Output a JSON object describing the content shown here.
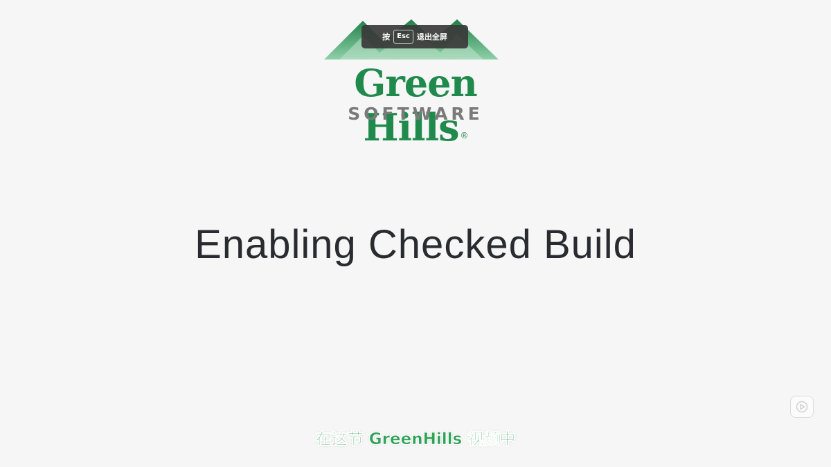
{
  "logo": {
    "wordmark": "Green Hills",
    "registered": "®",
    "subtitle": "SOFTWARE",
    "colors": {
      "green": "#1f8a4c",
      "gray": "#7a7a7a"
    }
  },
  "fullscreen_hint": {
    "prefix": "按",
    "key": "Esc",
    "suffix": "退出全屏"
  },
  "slide": {
    "title": "Enabling Checked Build"
  },
  "caption": {
    "text": "在这节 GreenHills 视频中"
  },
  "controls": {
    "play_icon": "play-icon"
  }
}
